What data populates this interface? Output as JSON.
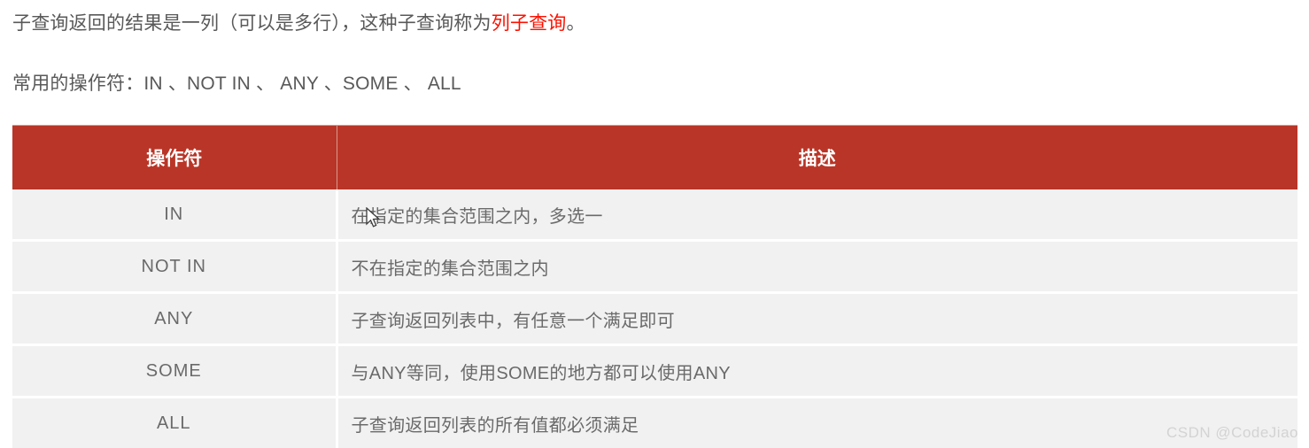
{
  "intro": {
    "line1_before": "子查询返回的结果是一列（可以是多行），这种子查询称为",
    "line1_highlight": "列子查询",
    "line1_after": "。",
    "line2": "常用的操作符：IN 、NOT IN 、 ANY 、SOME 、 ALL"
  },
  "table": {
    "headers": [
      "操作符",
      "描述"
    ],
    "rows": [
      {
        "operator": "IN",
        "description": "在指定的集合范围之内，多选一"
      },
      {
        "operator": "NOT IN",
        "description": "不在指定的集合范围之内"
      },
      {
        "operator": "ANY",
        "description": "子查询返回列表中，有任意一个满足即可"
      },
      {
        "operator": "SOME",
        "description": "与ANY等同，使用SOME的地方都可以使用ANY"
      },
      {
        "operator": "ALL",
        "description": "子查询返回列表的所有值都必须满足"
      }
    ]
  },
  "watermark": "CSDN @CodeJiao",
  "colors": {
    "header_background": "#b93527",
    "header_text": "#ffffff",
    "row_background": "#f1f1f1",
    "body_text": "#6a6a6a",
    "paragraph_text": "#595959",
    "highlight_text": "#fc1100",
    "watermark_text": "#d3d3d3"
  }
}
